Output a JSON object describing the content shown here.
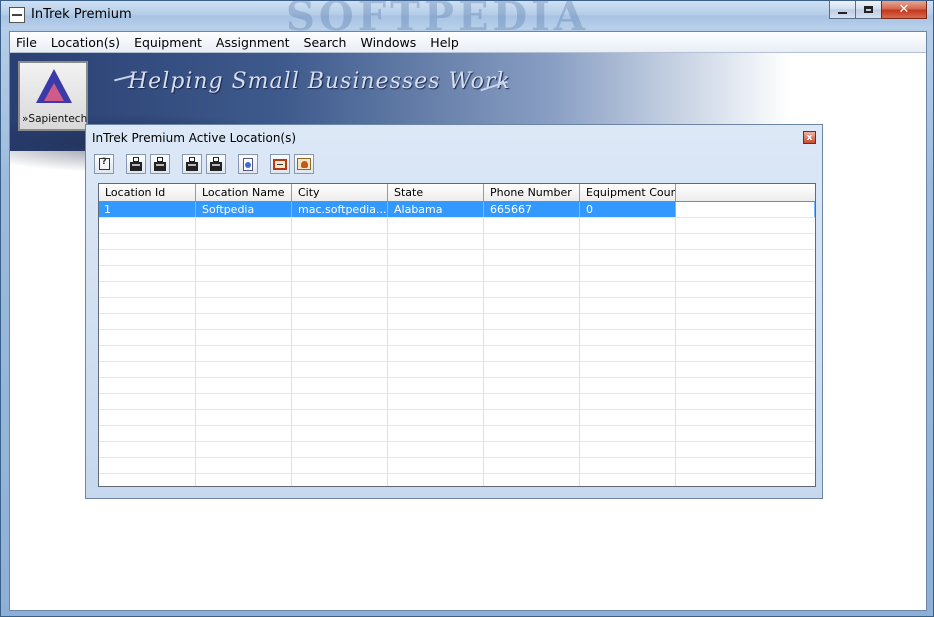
{
  "window": {
    "title": "InTrek Premium",
    "watermark": "SOFTPEDIA",
    "min_label": "",
    "close_label": "✕"
  },
  "menu": [
    "File",
    "Location(s)",
    "Equipment",
    "Assignment",
    "Search",
    "Windows",
    "Help"
  ],
  "banner": {
    "logo_text": "»Sapientech",
    "slogan": "Helping Small Businesses Work"
  },
  "child_window": {
    "title": "InTrek Premium Active Location(s)",
    "close_label": "x",
    "toolbar": [
      "help-icon",
      "printer-icon",
      "printer-icon",
      "printer-icon",
      "printer-icon",
      "document-icon",
      "card-icon",
      "person-icon"
    ]
  },
  "grid": {
    "columns": [
      "Location Id",
      "Location Name",
      "City",
      "State",
      "Phone Number",
      "Equipment Count"
    ],
    "rows": [
      [
        "1",
        "Softpedia",
        "mac.softpedia....",
        "Alabama",
        "665667",
        "0"
      ]
    ],
    "selected_row": 0,
    "empty_rows": 18
  },
  "colors": {
    "selection": "#3399ff",
    "title_bar": "#b7cfe9",
    "close_button": "#c2371b"
  }
}
